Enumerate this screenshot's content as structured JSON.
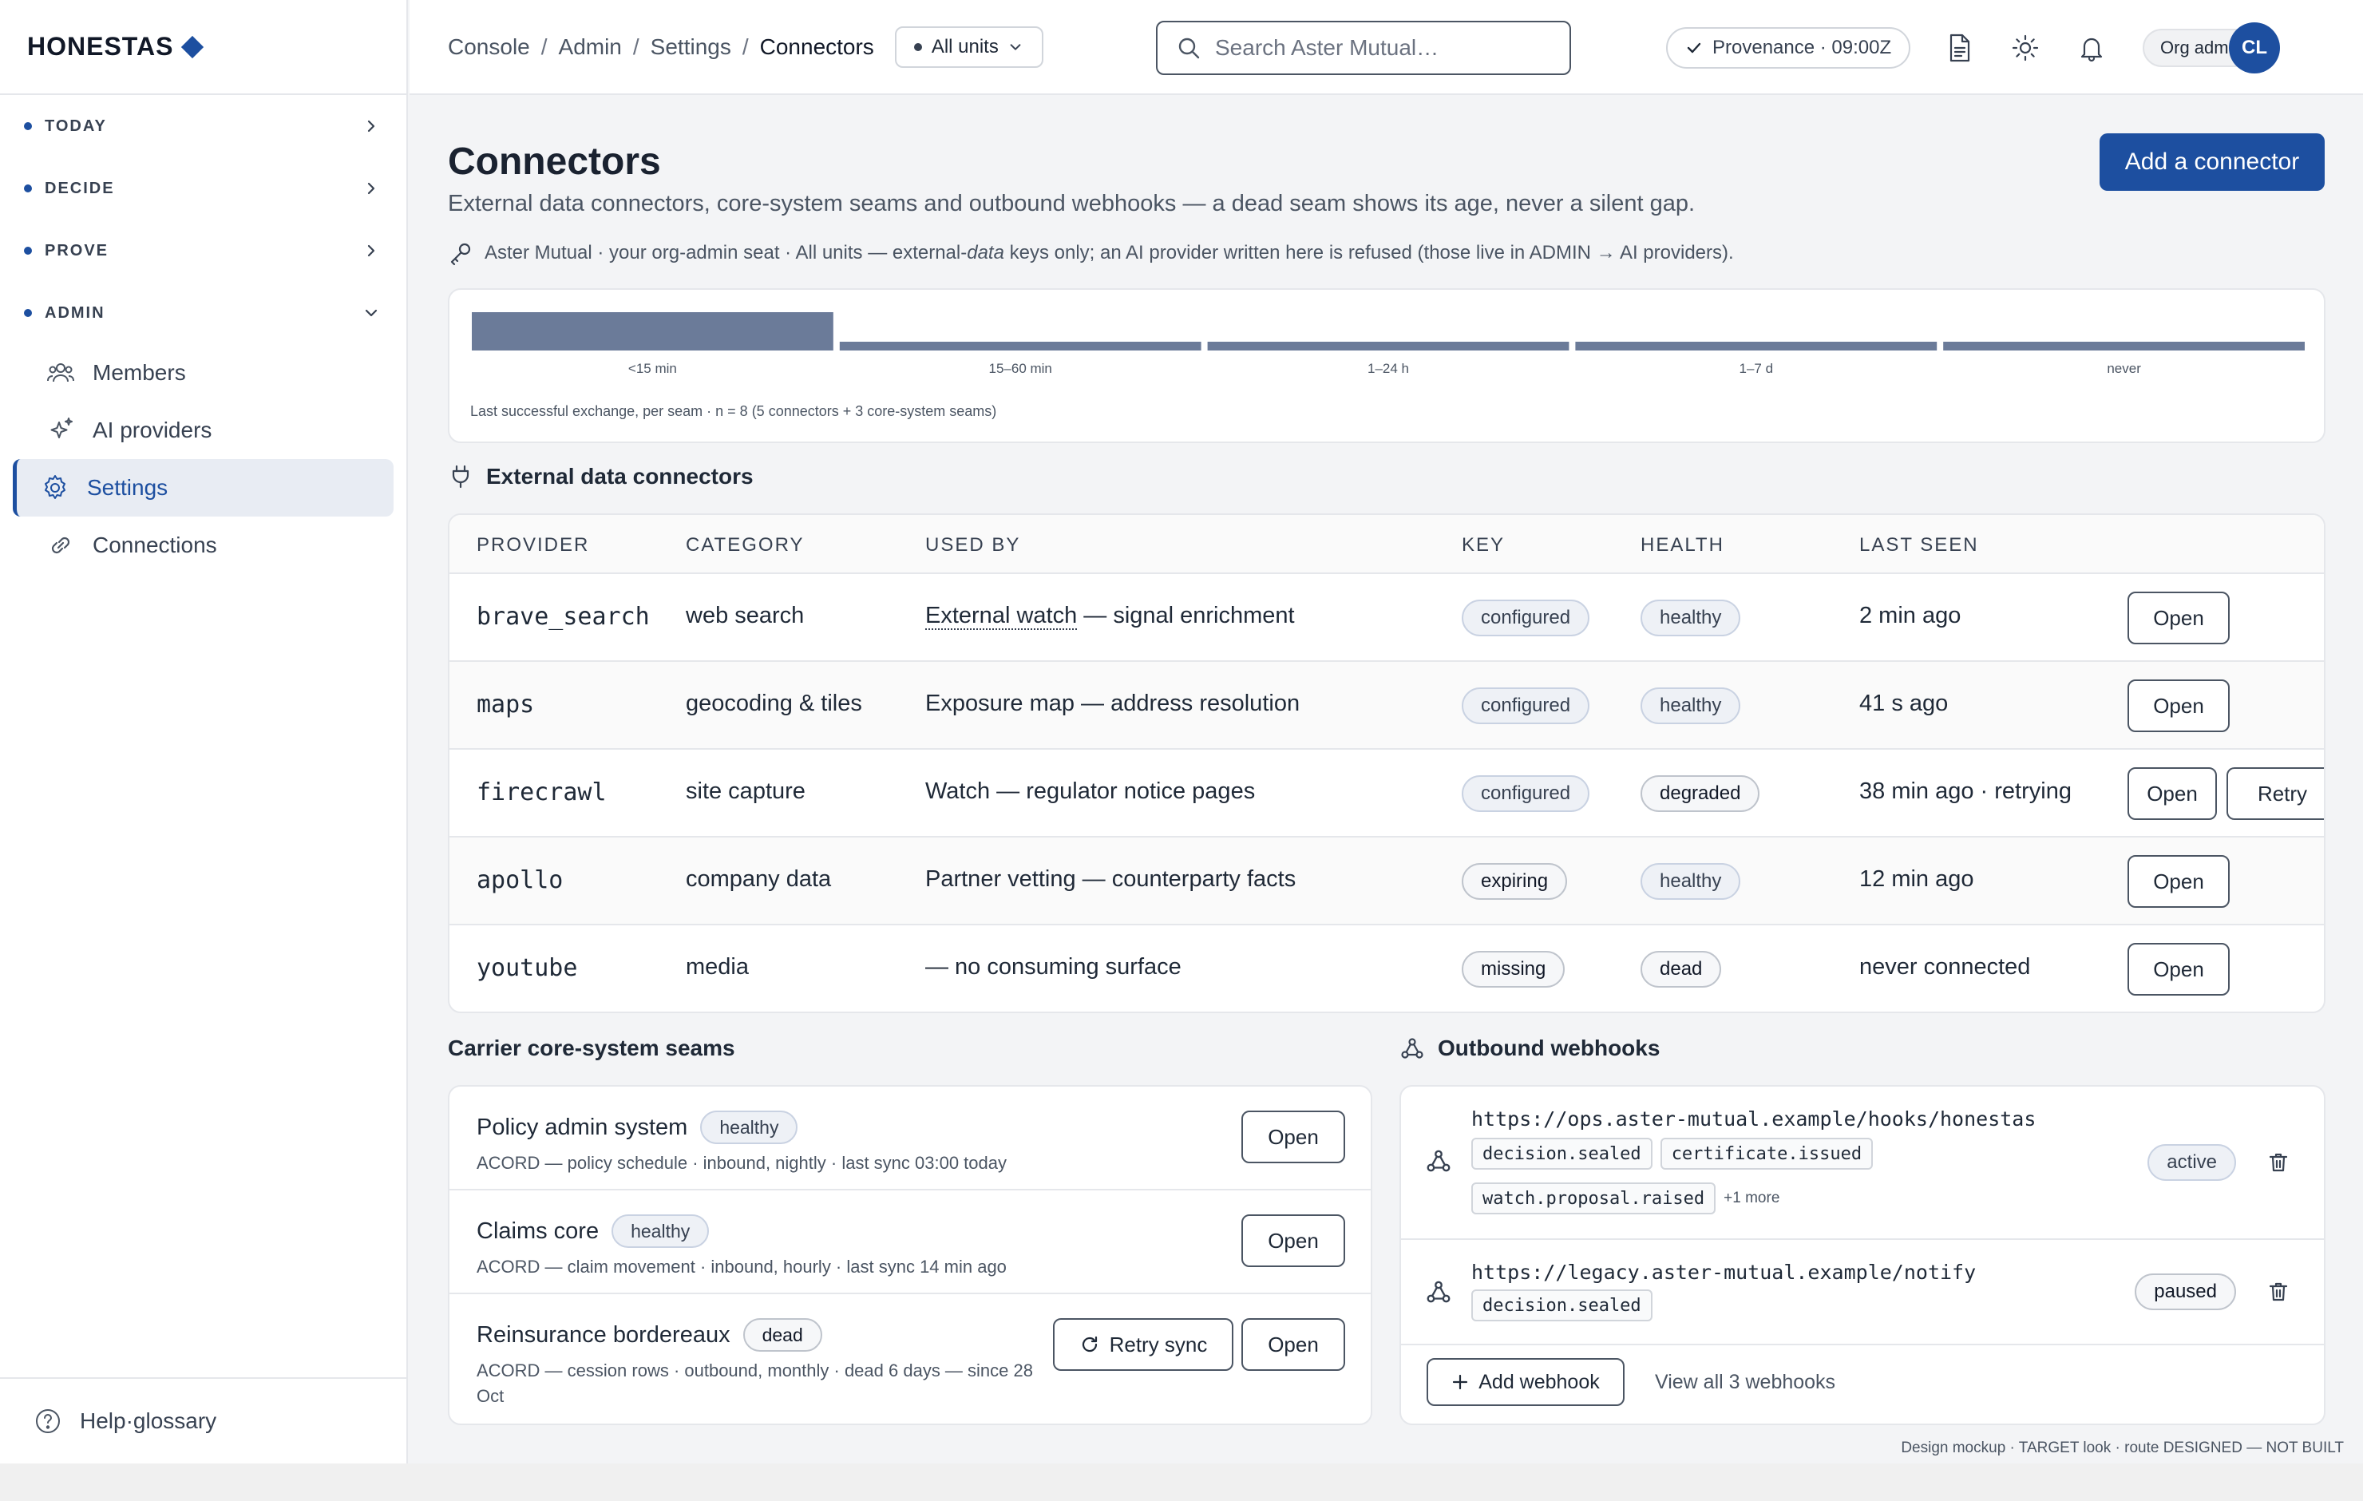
{
  "brand": {
    "name": "HONESTAS"
  },
  "sidebar": {
    "sections": [
      {
        "label": "TODAY"
      },
      {
        "label": "DECIDE"
      },
      {
        "label": "PROVE"
      },
      {
        "label": "ADMIN"
      }
    ],
    "admin_items": [
      {
        "label": "Members",
        "icon": "members-icon"
      },
      {
        "label": "AI providers",
        "icon": "sparkle-icon"
      },
      {
        "label": "Settings",
        "icon": "gear-icon",
        "active": true
      },
      {
        "label": "Connections",
        "icon": "link-icon"
      }
    ],
    "footer": {
      "label": "Help·glossary",
      "icon": "help-icon"
    }
  },
  "topbar": {
    "breadcrumb": [
      "Console",
      "Admin",
      "Settings",
      "Connectors"
    ],
    "unit_selector": "All units",
    "search_placeholder": "Search Aster Mutual…",
    "provenance": "Provenance · 09:00Z",
    "role": "Org admin",
    "avatar_initials": "CL"
  },
  "page": {
    "title": "Connectors",
    "subtitle": "External data connectors, core-system seams and outbound webhooks — a dead seam shows its age, never a silent gap.",
    "scope_line_parts": [
      "Aster Mutual · your org-admin seat · All units — external-",
      "data",
      " keys only; an AI provider written here is refused (those live in ADMIN → AI providers)."
    ],
    "primary_action": "Add a connector"
  },
  "chart_data": {
    "type": "bar",
    "title": "",
    "caption": "Last successful exchange, per seam · n = 8 (5 connectors + 3 core-system seams)",
    "categories": [
      "<15 min",
      "15–60 min",
      "1–24 h",
      "1–7 d",
      "never"
    ],
    "values": [
      6,
      0,
      0,
      1,
      1
    ],
    "ylim": [
      0,
      6
    ],
    "accent": "#6b7b99"
  },
  "connectors": {
    "heading": "External data connectors",
    "columns": [
      "PROVIDER",
      "CATEGORY",
      "USED BY",
      "KEY",
      "HEALTH",
      "LAST SEEN"
    ],
    "rows": [
      {
        "provider": "brave_search",
        "category": "web search",
        "used_link": "External watch",
        "used_rest": " — signal enrichment",
        "key": "configured",
        "health": "healthy",
        "last_seen": "2 min ago",
        "open": "Open"
      },
      {
        "provider": "maps",
        "category": "geocoding & tiles",
        "used_link": "",
        "used_rest": "Exposure map — address resolution",
        "key": "configured",
        "health": "healthy",
        "last_seen": "41 s ago",
        "open": "Open"
      },
      {
        "provider": "firecrawl",
        "category": "site capture",
        "used_link": "",
        "used_rest": "Watch — regulator notice pages",
        "key": "configured",
        "health": "degraded",
        "last_seen": "38 min ago · retrying",
        "open": "Open",
        "retry": "Retry"
      },
      {
        "provider": "apollo",
        "category": "company data",
        "used_link": "",
        "used_rest": "Partner vetting — counterparty facts",
        "key": "expiring",
        "health": "healthy",
        "last_seen": "12 min ago",
        "open": "Open"
      },
      {
        "provider": "youtube",
        "category": "media",
        "used_link": "",
        "used_rest": "— no consuming surface",
        "key": "missing",
        "health": "dead",
        "last_seen": "never connected",
        "open": "Open"
      }
    ]
  },
  "seams": {
    "heading": "Carrier core-system seams",
    "items": [
      {
        "name": "Policy admin system",
        "status": "healthy",
        "detail": "ACORD — policy schedule · inbound, nightly · last sync 03:00 today",
        "open": "Open"
      },
      {
        "name": "Claims core",
        "status": "healthy",
        "detail": "ACORD — claim movement · inbound, hourly · last sync 14 min ago",
        "open": "Open"
      },
      {
        "name": "Reinsurance bordereaux",
        "status": "dead",
        "detail": "ACORD — cession rows · outbound, monthly · dead 6 days — since 28 Oct",
        "open": "Open",
        "retry": "Retry sync"
      }
    ]
  },
  "webhooks": {
    "heading": "Outbound webhooks",
    "items": [
      {
        "url": "https://ops.aster-mutual.example/hooks/honestas",
        "events": [
          "decision.sealed",
          "certificate.issued",
          "watch.proposal.raised"
        ],
        "more": "+1 more",
        "status": "active"
      },
      {
        "url": "https://legacy.aster-mutual.example/notify",
        "events": [
          "decision.sealed"
        ],
        "more": "",
        "status": "paused"
      }
    ],
    "add_label": "Add webhook",
    "view_all": "View all 3 webhooks"
  },
  "footer_note": "Design mockup · TARGET look · route DESIGNED — NOT BUILT"
}
